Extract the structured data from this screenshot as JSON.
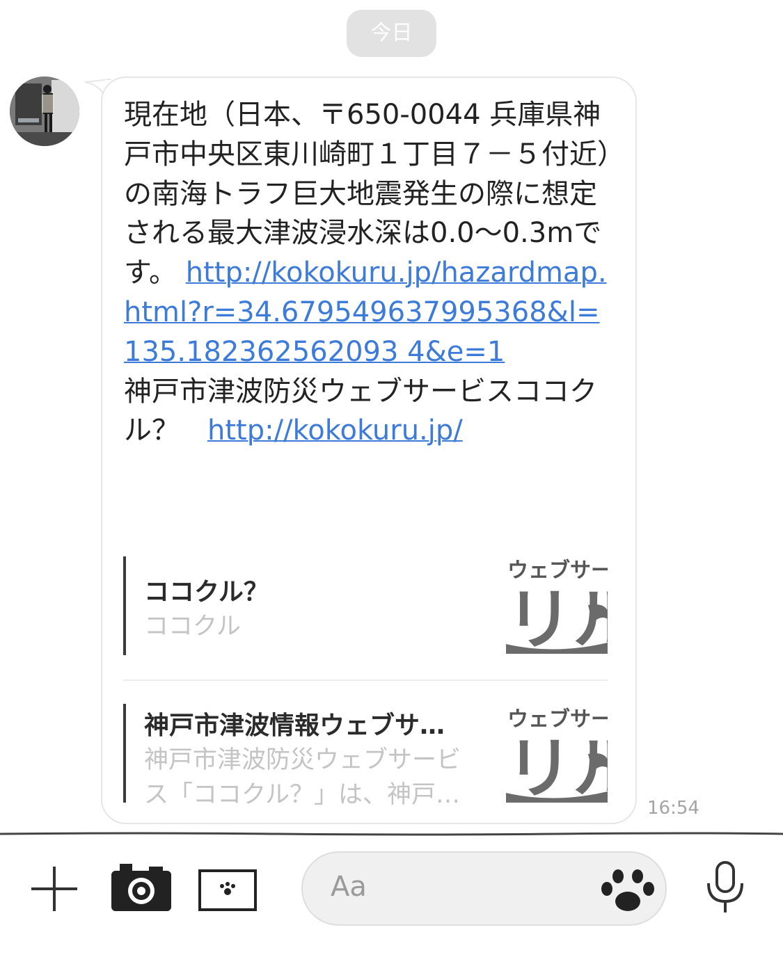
{
  "date_chip": "今日",
  "message": {
    "text_before_link": "現在地（日本、〒650-0044 兵庫県神戸市中央区東川崎町１丁目７－５付近）の南海トラフ巨大地震発生の際に想定される最大津波浸水深は0.0〜0.3mです。 ",
    "link1": "http://kokokuru.jp/hazardmap.html?r=34.679549637995368&l=135.182362562093 4&e=1",
    "text_after_link": "神戸市津波防災ウェブサービスココクル？　",
    "link2": "http://kokokuru.jp/",
    "timestamp": "16:54"
  },
  "previews": [
    {
      "title": "ココクル？",
      "description": "ココクル",
      "thumb_text_top": "ウェブサー",
      "thumb_text_big": "ル",
      "thumb_text_big_prefix": "リ"
    },
    {
      "title": "神戸市津波情報ウェブサ…",
      "description": "神戸市津波防災ウェブサービス「ココクル？」は、神戸…",
      "thumb_text_top": "ウェブサー",
      "thumb_text_big": "ル",
      "thumb_text_big_prefix": "リ"
    }
  ],
  "input": {
    "placeholder": "Aa"
  },
  "icons": {
    "plus": "plus-icon",
    "camera": "camera-icon",
    "photo": "photo-icon",
    "sticker": "paw-sticker-icon",
    "mic": "microphone-icon"
  }
}
